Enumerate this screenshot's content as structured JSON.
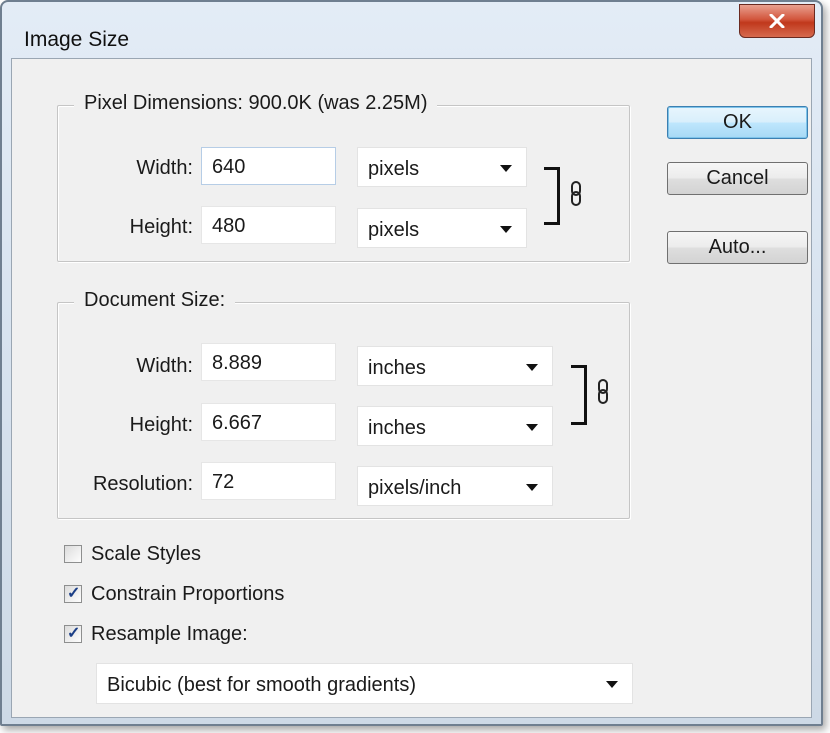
{
  "window": {
    "title": "Image Size"
  },
  "buttons": {
    "ok": "OK",
    "cancel": "Cancel",
    "auto": "Auto..."
  },
  "pixel_dimensions": {
    "legend": "Pixel Dimensions:  900.0K (was 2.25M)",
    "width_label": "Width:",
    "width_value": "640",
    "width_unit": "pixels",
    "height_label": "Height:",
    "height_value": "480",
    "height_unit": "pixels"
  },
  "document_size": {
    "legend": "Document Size:",
    "width_label": "Width:",
    "width_value": "8.889",
    "width_unit": "inches",
    "height_label": "Height:",
    "height_value": "6.667",
    "height_unit": "inches",
    "resolution_label": "Resolution:",
    "resolution_value": "72",
    "resolution_unit": "pixels/inch"
  },
  "options": {
    "scale_styles": {
      "label": "Scale Styles",
      "checked": false
    },
    "constrain_proportions": {
      "label": "Constrain Proportions",
      "checked": true
    },
    "resample_image": {
      "label": "Resample Image:",
      "checked": true
    }
  },
  "resample_method": "Bicubic (best for smooth gradients)",
  "check_glyph": "✓",
  "colors": {
    "default_button": "#bee6fd",
    "close_button": "#c0381c"
  }
}
